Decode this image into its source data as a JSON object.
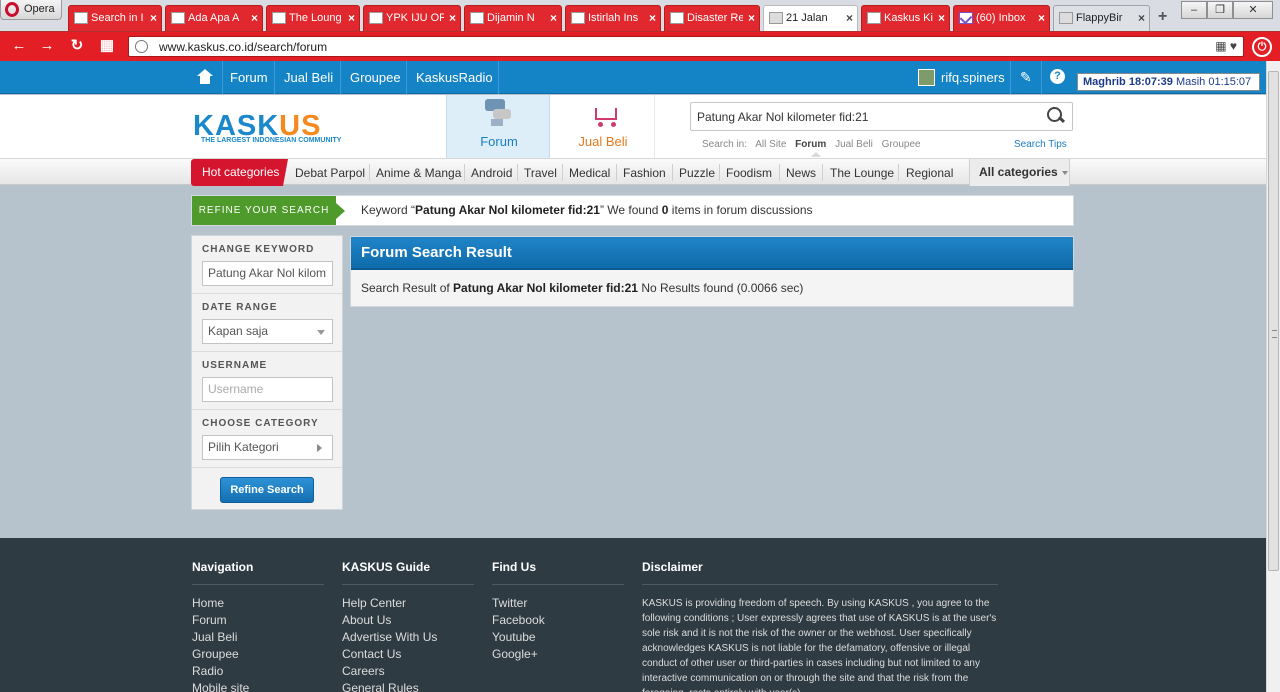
{
  "browser": {
    "opera_label": "Opera",
    "tabs": [
      {
        "title": "Search in I",
        "state": "red"
      },
      {
        "title": "Ada Apa A",
        "state": "red"
      },
      {
        "title": "The Loung",
        "state": "red"
      },
      {
        "title": "YPK IJU OFI",
        "state": "red"
      },
      {
        "title": "Dijamin N",
        "state": "red"
      },
      {
        "title": "Istirlah Ins",
        "state": "red"
      },
      {
        "title": "Disaster Re",
        "state": "red"
      },
      {
        "title": "21 Jalan",
        "state": "active"
      },
      {
        "title": "Kaskus Kia",
        "state": "red"
      },
      {
        "title": "(60) Inbox",
        "state": "red"
      },
      {
        "title": "FlappyBir",
        "state": "grey"
      }
    ],
    "url": "www.kaskus.co.id/search/forum",
    "window_buttons": [
      "–",
      "❐",
      "✕"
    ]
  },
  "topnav": {
    "items": [
      "Forum",
      "Jual Beli",
      "Groupee",
      "KaskusRadio"
    ],
    "username": "rifq.spiners",
    "prayer_time": "Maghrib 18:07:39",
    "remaining": "Masih 01:15:07"
  },
  "header": {
    "logo_text_a": "KASK",
    "logo_text_b": "US",
    "logo_tagline": "THE LARGEST INDONESIAN COMMUNITY",
    "tab_forum": "Forum",
    "tab_jualbeli": "Jual Beli",
    "search_value": "Patung Akar Nol kilometer fid:21",
    "search_in_label": "Search in:",
    "search_scopes": [
      "All Site",
      "Forum",
      "Jual Beli",
      "Groupee"
    ],
    "search_tips": "Search Tips"
  },
  "categories": {
    "hot": "Hot categories",
    "items": [
      "Debat Parpol",
      "Anime & Manga",
      "Android",
      "Travel",
      "Medical",
      "Fashion",
      "Puzzle",
      "Foodism",
      "News",
      "The Lounge",
      "Regional"
    ],
    "all": "All categories"
  },
  "refine": {
    "title": "REFINE YOUR SEARCH",
    "keyword_prefix": "Keyword “",
    "keyword": "Patung Akar Nol kilometer fid:21",
    "keyword_mid": "” We found ",
    "count": "0",
    "keyword_suffix": " items in forum discussions"
  },
  "sidebar": {
    "change_keyword_label": "CHANGE KEYWORD",
    "keyword_value": "Patung Akar Nol kilom",
    "date_range_label": "DATE RANGE",
    "date_range_value": "Kapan saja",
    "username_label": "USERNAME",
    "username_placeholder": "Username",
    "category_label": "CHOOSE CATEGORY",
    "category_value": "Pilih Kategori",
    "refine_button": "Refine Search"
  },
  "result": {
    "header": "Forum Search Result",
    "prefix": "Search Result of ",
    "keyword": "Patung Akar Nol kilometer fid:21",
    "suffix": " No Results found (0.0066 sec)"
  },
  "footer": {
    "navigation": {
      "title": "Navigation",
      "links": [
        "Home",
        "Forum",
        "Jual Beli",
        "Groupee",
        "Radio",
        "Mobile site"
      ]
    },
    "guide": {
      "title": "KASKUS Guide",
      "links": [
        "Help Center",
        "About Us",
        "Advertise With Us",
        "Contact Us",
        "Careers",
        "General Rules"
      ]
    },
    "findus": {
      "title": "Find Us",
      "links": [
        "Twitter",
        "Facebook",
        "Youtube",
        "Google+"
      ]
    },
    "disclaimer": {
      "title": "Disclaimer",
      "text": "KASKUS is providing freedom of speech. By using KASKUS , you agree to the following conditions ; User expressly agrees that use of KASKUS is at the user's sole risk and it is not the risk of the owner or the webhost. User specifically acknowledges KASKUS is not liable for the defamatory, offensive or illegal conduct of other user or third-parties in cases including but not limited to any interactive communication on or through the site and that the risk from the foregoing, rests entirely with user(s)."
    }
  }
}
